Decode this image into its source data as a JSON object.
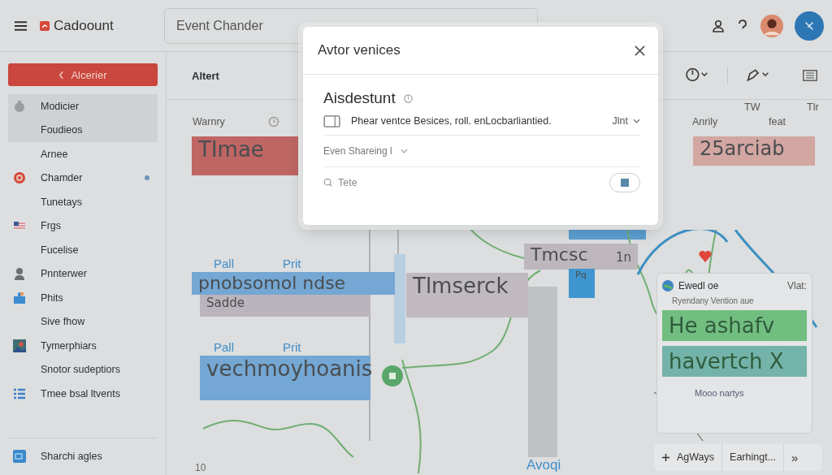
{
  "topbar": {
    "app_name": "Cadoount",
    "search": {
      "value": "Event Chander"
    }
  },
  "sidebar": {
    "primary_button": "Alcerier",
    "items": [
      {
        "label": "Modicier",
        "selected": true,
        "dot": false
      },
      {
        "label": "Foudieos",
        "selected": true,
        "dot": false
      },
      {
        "label": "Arnee",
        "selected": false,
        "dot": false
      },
      {
        "label": "Chamder",
        "selected": false,
        "dot": true
      },
      {
        "label": "Tunetays",
        "selected": false,
        "dot": false
      },
      {
        "label": "Frgs",
        "selected": false,
        "dot": false
      },
      {
        "label": "Fucelise",
        "selected": false,
        "dot": false
      },
      {
        "label": "Pnnterwer",
        "selected": false,
        "dot": false
      },
      {
        "label": "Phits",
        "selected": false,
        "dot": false
      },
      {
        "label": "Sive fhow",
        "selected": false,
        "dot": false
      },
      {
        "label": "Tymerphiars",
        "selected": false,
        "dot": false
      },
      {
        "label": "Snotor sudeptiors",
        "selected": false,
        "dot": false
      },
      {
        "label": "Tmee bsal ltvents",
        "selected": false,
        "dot": false
      }
    ],
    "footer_item": "Sharchi agles"
  },
  "main": {
    "title": "Altert",
    "column_labels": [
      "Warnry",
      "Anrily",
      "feat"
    ],
    "top_labels": [
      "TW",
      "Tlr"
    ],
    "lane_labels": [
      "Pall",
      "Prit",
      "Pall",
      "Prit"
    ],
    "events": [
      {
        "title": "TImae",
        "color": "#bf6664"
      },
      {
        "title": "25arciab",
        "color": "#d2a6a1"
      },
      {
        "title": "pnobsomol ndse",
        "color": "#74a7d3"
      },
      {
        "title": "Sadde",
        "color": "#bab4bc"
      },
      {
        "title": "Tlmserck",
        "color": "#c0b9c0"
      },
      {
        "title": "Tmcsc",
        "color": "#bdb7bd",
        "tag": "1n"
      },
      {
        "title": "vechmoyhoanis",
        "color": "#74a7d3"
      },
      {
        "title": "Pq",
        "color": "#3f95cf"
      }
    ],
    "bottom_labels": [
      "10",
      "Avoqi"
    ],
    "card": {
      "title": "Ewedl oe",
      "meta": "Vlat:",
      "subtitle": "Ryendany Vention aue",
      "bars": [
        {
          "text": "He ashafv",
          "color": "#72bd80"
        },
        {
          "text": "havertch X",
          "color": "#74b3a9"
        }
      ],
      "footer": "Mooo nartys"
    },
    "bottom_actions": [
      {
        "label": "AgWays",
        "kind": "add"
      },
      {
        "label": "Earhingt...",
        "kind": "plain"
      },
      {
        "label": "»",
        "kind": "plain"
      }
    ]
  },
  "dialog": {
    "title": "Avtor venices",
    "section": "Aisdestunt",
    "description": "Phear ventce Besices, roll. enLocbarliantied.",
    "select": "Jlnt",
    "dropdown": "Even Shareing l",
    "search": {
      "value": "Tete"
    },
    "toggle": {
      "on": true
    }
  }
}
